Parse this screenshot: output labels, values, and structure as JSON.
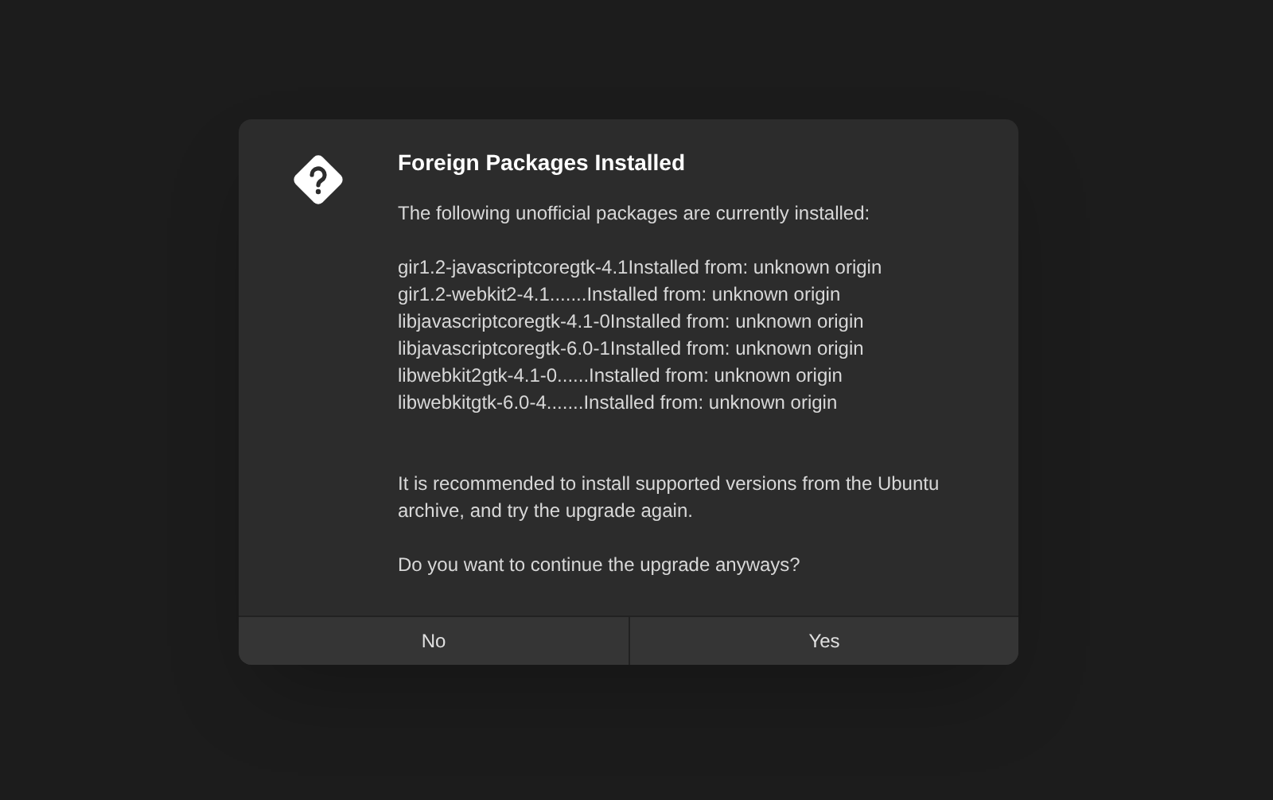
{
  "dialog": {
    "title": "Foreign Packages Installed",
    "intro": "The following unofficial packages are currently installed:",
    "packages": [
      "gir1.2-javascriptcoregtk-4.1Installed from: unknown origin",
      "gir1.2-webkit2-4.1.......Installed from: unknown origin",
      "libjavascriptcoregtk-4.1-0Installed from: unknown origin",
      "libjavascriptcoregtk-6.0-1Installed from: unknown origin",
      "libwebkit2gtk-4.1-0......Installed from: unknown origin",
      "libwebkitgtk-6.0-4.......Installed from: unknown origin"
    ],
    "recommendation": "It is recommended to install supported versions from the Ubuntu archive, and try the upgrade again.",
    "question": "Do you want to continue the upgrade anyways?",
    "buttons": [
      "No",
      "Yes"
    ]
  }
}
